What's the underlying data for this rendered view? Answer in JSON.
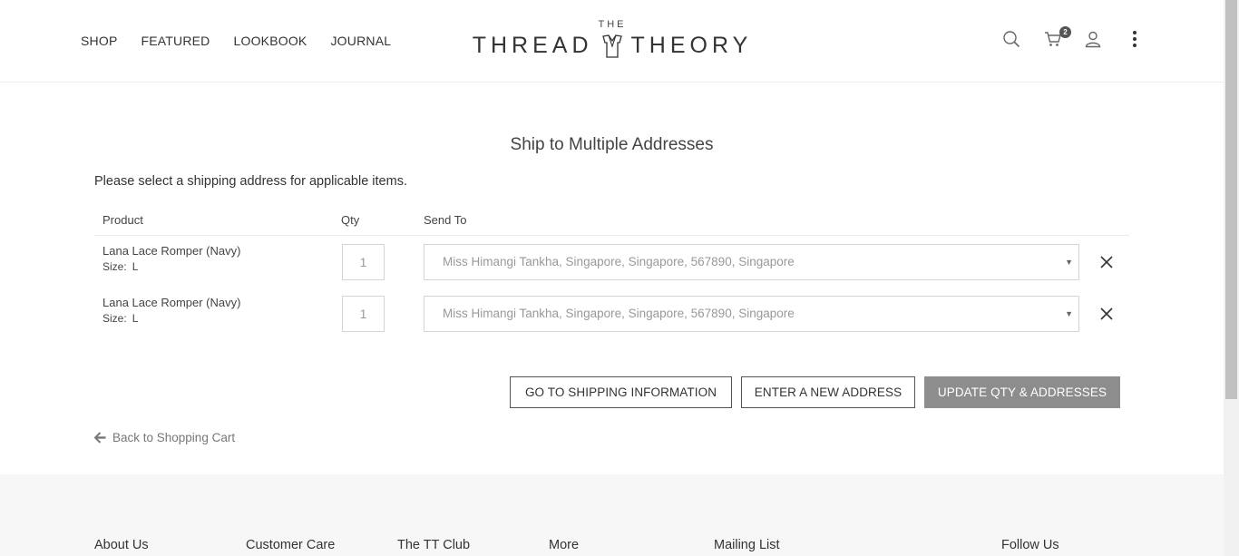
{
  "header": {
    "nav": [
      "SHOP",
      "FEATURED",
      "LOOKBOOK",
      "JOURNAL"
    ],
    "logo_small": "THE",
    "logo_left": "THREAD",
    "logo_right": "THEORY",
    "cart_count": "2",
    "icons": [
      "search-icon",
      "cart-icon",
      "user-icon",
      "more-vertical-icon"
    ]
  },
  "main": {
    "title": "Ship to Multiple Addresses",
    "intro": "Please select a shipping address for applicable items.",
    "columns": {
      "product": "Product",
      "qty": "Qty",
      "send_to": "Send To"
    },
    "rows": [
      {
        "name": "Lana Lace Romper (Navy)",
        "size_label": "Size:",
        "size": "L",
        "qty": "1",
        "address": "Miss Himangi Tankha, Singapore, Singapore, 567890, Singapore"
      },
      {
        "name": "Lana Lace Romper (Navy)",
        "size_label": "Size:",
        "size": "L",
        "qty": "1",
        "address": "Miss Himangi Tankha, Singapore, Singapore, 567890, Singapore"
      }
    ],
    "buttons": {
      "shipping": "GO TO SHIPPING INFORMATION",
      "new_address": "ENTER A NEW ADDRESS",
      "update": "UPDATE QTY & ADDRESSES"
    },
    "back_link": "Back to Shopping Cart"
  },
  "footer": {
    "columns": [
      "About Us",
      "Customer Care",
      "The TT Club",
      "More",
      "Mailing List",
      "Follow Us"
    ]
  },
  "colors": {
    "update_button": "#8d8d8d",
    "footer_bg": "#f7f7f7"
  }
}
